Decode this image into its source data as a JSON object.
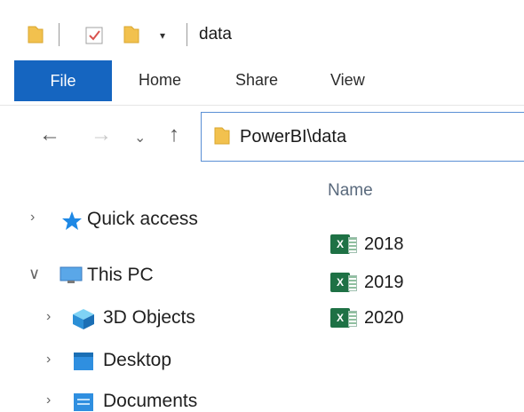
{
  "window": {
    "title": "data"
  },
  "ribbon": {
    "tabs": [
      {
        "label": "File",
        "active": true
      },
      {
        "label": "Home"
      },
      {
        "label": "Share"
      },
      {
        "label": "View"
      }
    ]
  },
  "address": {
    "path": "PowerBI\\data"
  },
  "navigation": {
    "items": [
      {
        "label": "Quick access",
        "expanded": false
      },
      {
        "label": "This PC",
        "expanded": true
      },
      {
        "label": "3D Objects",
        "expanded": false
      },
      {
        "label": "Desktop",
        "expanded": false
      },
      {
        "label": "Documents",
        "expanded": false
      }
    ]
  },
  "files": {
    "column_header": "Name",
    "items": [
      {
        "name": "2018",
        "type": "excel"
      },
      {
        "name": "2019",
        "type": "excel"
      },
      {
        "name": "2020",
        "type": "excel"
      }
    ]
  },
  "colors": {
    "accent": "#1565c0",
    "excel": "#1e7145",
    "folder": "#f2c14e"
  }
}
